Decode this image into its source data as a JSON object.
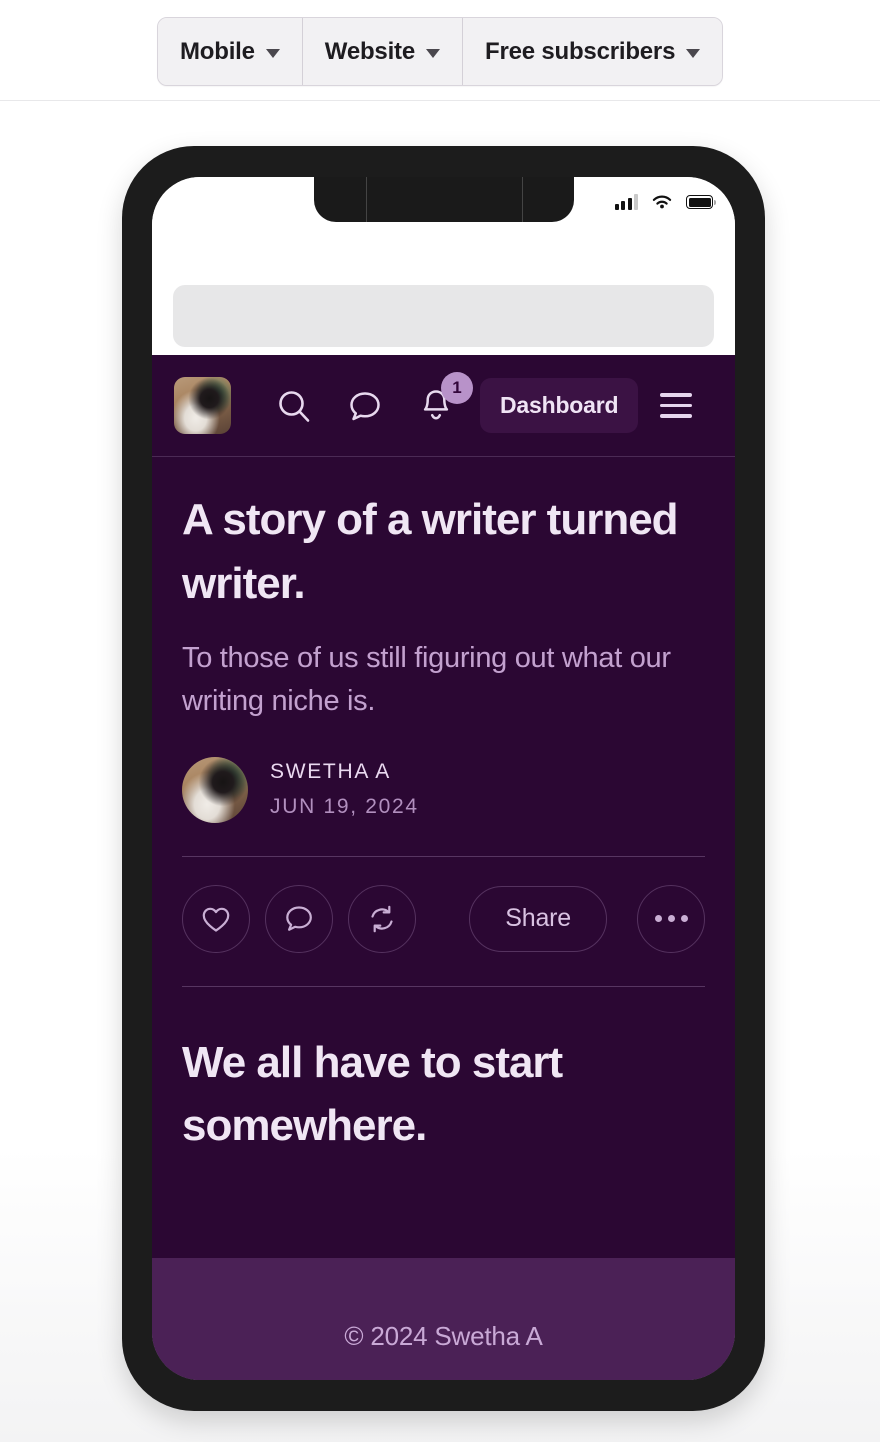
{
  "toolbar": {
    "segments": [
      {
        "label": "Mobile",
        "icon": "chevron-down-icon"
      },
      {
        "label": "Website",
        "icon": "chevron-down-icon"
      },
      {
        "label": "Free subscribers",
        "icon": "chevron-down-icon"
      }
    ]
  },
  "phone": {
    "status_bar": {
      "signal_icon": "cellular-signal-icon",
      "signal_bars_filled": 3,
      "signal_bars_total": 4,
      "wifi_icon": "wifi-icon",
      "battery_icon": "battery-full-icon"
    },
    "browser": {
      "url_value": "",
      "url_placeholder": ""
    }
  },
  "app": {
    "nav": {
      "avatar_name": "user-avatar",
      "search_icon": "search-icon",
      "comment_icon": "chat-bubble-icon",
      "bell_icon": "bell-icon",
      "notification_count": "1",
      "dashboard_label": "Dashboard",
      "menu_icon": "hamburger-menu-icon"
    },
    "post": {
      "title": "A story of a writer turned writer.",
      "subtitle": "To those of us still figuring out what our writing niche is.",
      "author": "SWETHA A",
      "date": "JUN 19, 2024"
    },
    "actions": {
      "like_icon": "heart-icon",
      "comment_icon": "chat-bubble-icon",
      "restack_icon": "restack-refresh-icon",
      "share_label": "Share",
      "more_icon": "ellipsis-icon"
    },
    "section_two": {
      "heading": "We all have to start somewhere."
    },
    "footer": {
      "copyright": "© 2024 Swetha A"
    }
  },
  "colors": {
    "app_background": "#2b0733",
    "footer_background": "#4b2156",
    "accent_badge": "#b892c9",
    "title_text": "#f0e6f4",
    "muted_text": "#c3a1cf",
    "phone_frame": "#1c1c1c"
  }
}
